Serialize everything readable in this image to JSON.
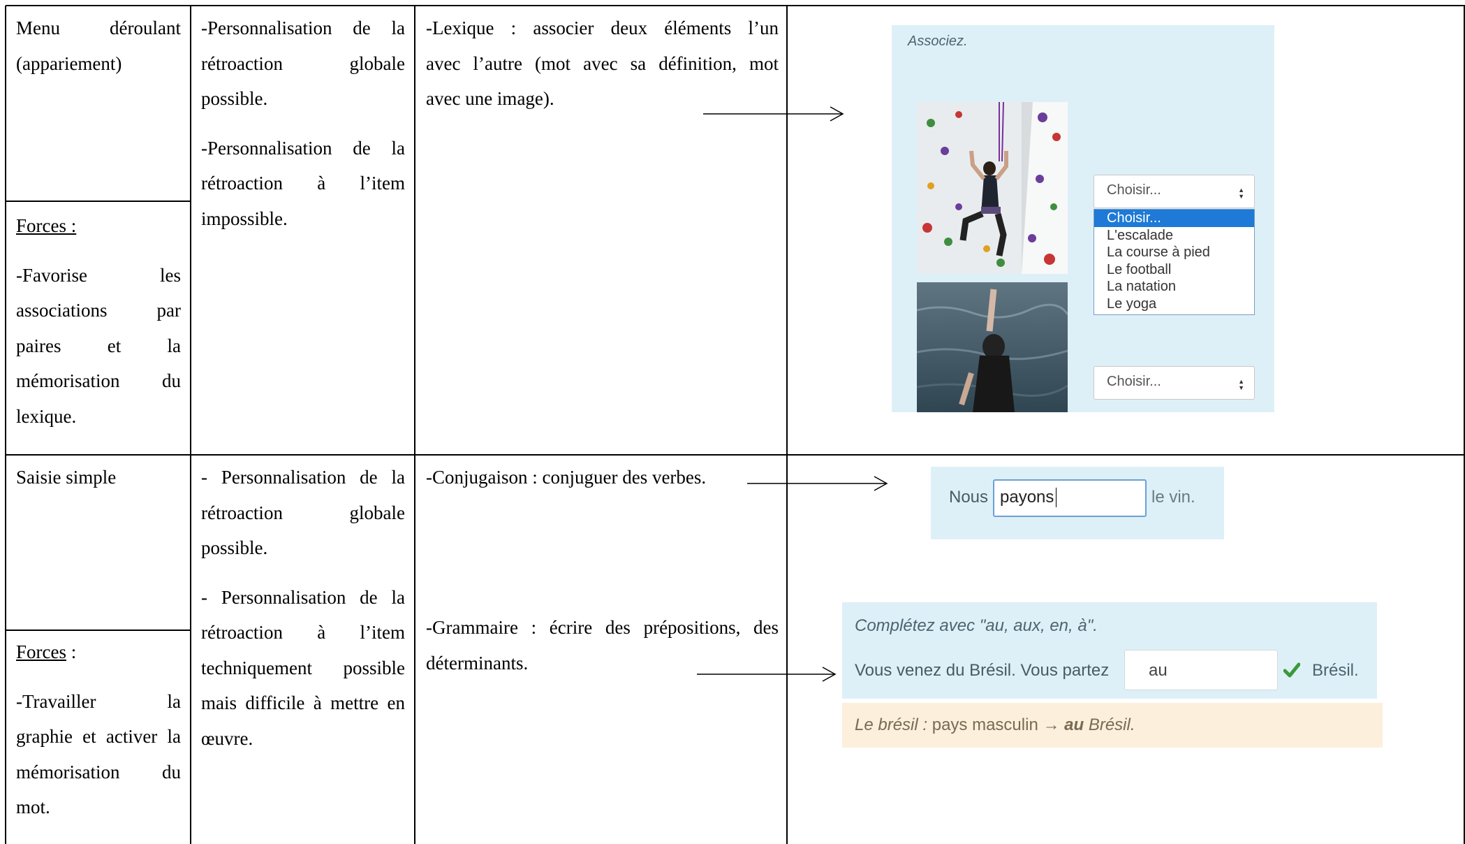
{
  "row1": {
    "col1_title": [
      "Menu déroulant",
      "(appariement)"
    ],
    "col1_forces_label": "Forces :",
    "col1_forces_text": [
      "-Favorise les",
      "associations par",
      "paires et la",
      "mémorisation du",
      "lexique."
    ],
    "col2_p1": [
      "-Personnalisation de la",
      "rétroaction globale",
      "possible."
    ],
    "col2_p2": [
      "-Personnalisation de la",
      "rétroaction à l’item",
      "impossible."
    ],
    "col3_text": [
      "-Lexique : associer deux éléments l’un",
      "avec l’autre (mot avec sa définition, mot",
      "avec une image)."
    ],
    "mock": {
      "instruction": "Associez.",
      "select1_label": "Choisir...",
      "select2_label": "Choisir...",
      "options": [
        "Choisir...",
        "L'escalade",
        "La course à pied",
        "Le football",
        "La natation",
        "Le yoga"
      ],
      "selected_option": "Choisir...",
      "photo_top": "climbing-photo",
      "photo_bottom": "swimming-photo"
    }
  },
  "row2": {
    "col1_title": "Saisie simple",
    "col1_forces_label": "Forces",
    "col1_forces_suffix": " :",
    "col1_forces_text": [
      "-Travailler la",
      "graphie et activer la",
      "mémorisation du",
      "mot."
    ],
    "col2_p1": [
      "- Personnalisation de la",
      "rétroaction globale",
      "possible."
    ],
    "col2_p2": [
      "- Personnalisation de la",
      "rétroaction à l’item",
      "techniquement possible",
      "mais difficile à mettre en",
      "œuvre."
    ],
    "col3_conj": "-Conjugaison : conjuguer des verbes.",
    "col3_gram": [
      "-Grammaire : écrire des prépositions, des",
      "déterminants."
    ],
    "mock_conj": {
      "prefix": "Nous",
      "input_value": "payons",
      "suffix": "le vin."
    },
    "mock_gram": {
      "instruction": "Complétez avec \"au, aux, en, à\".",
      "prefix": "Vous venez du Brésil. Vous partez",
      "input_value": "au",
      "suffix": "Brésil.",
      "feedback_italic_1": "Le brésil :",
      "feedback_plain": " pays masculin → ",
      "feedback_bold": "au",
      "feedback_italic_2": " Brésil."
    }
  },
  "colors": {
    "mock_bg": "#def0f7",
    "feedback_bg": "#fcefdc",
    "check": "#3a9a3a",
    "selection": "#1e7ad6"
  }
}
